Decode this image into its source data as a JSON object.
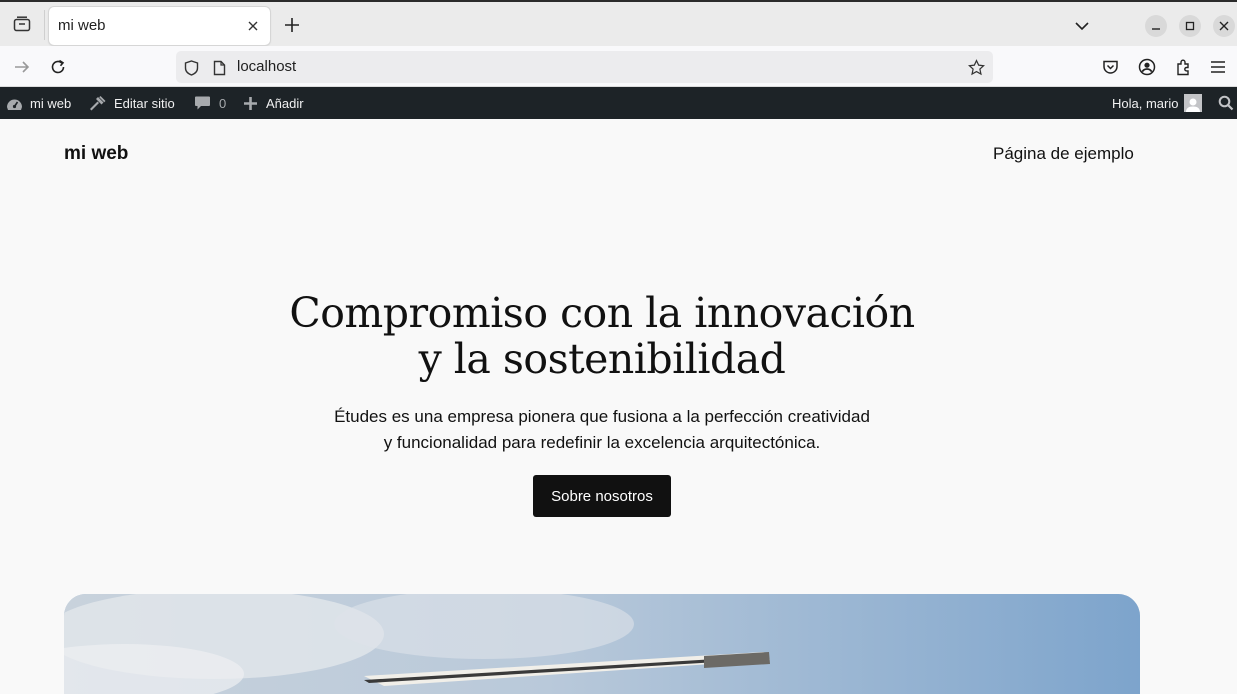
{
  "browser": {
    "tab_title": "mi web",
    "url": "localhost"
  },
  "adminbar": {
    "site_name": "mi web",
    "edit_site": "Editar sitio",
    "comments_count": "0",
    "add_new": "Añadir",
    "greeting": "Hola, mario"
  },
  "site": {
    "title": "mi web",
    "nav_link": "Página de ejemplo"
  },
  "hero": {
    "title_line1": "Compromiso con la innovación",
    "title_line2": "y la sostenibilidad",
    "desc_line1": "Études es una empresa pionera que fusiona a la perfección creatividad",
    "desc_line2": "y funcionalidad para redefinir la excelencia arquitectónica.",
    "button": "Sobre nosotros"
  },
  "colors": {
    "admin_bar": "#1d2327",
    "button_bg": "#111111",
    "page_bg": "#f9f9f9"
  }
}
